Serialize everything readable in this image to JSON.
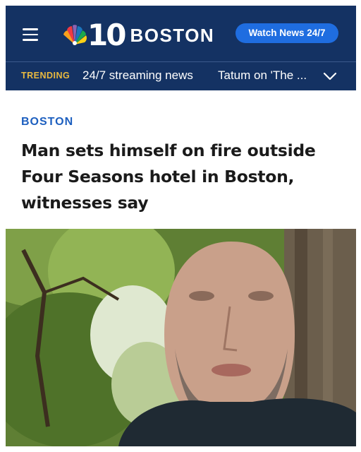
{
  "header": {
    "logo_number": "10",
    "logo_city": "BOSTON",
    "watch_button_label": "Watch News 24/7",
    "trending_label": "TRENDING",
    "trending_items": [
      "24/7 streaming news",
      "Tatum on 'The ..."
    ]
  },
  "article": {
    "section": "BOSTON",
    "headline": "Man sets himself on fire outside Four Seasons hotel in Boston, witnesses say"
  },
  "icons": {
    "menu": "hamburger-menu-icon",
    "logo": "nbc-peacock-logo-icon",
    "expand": "chevron-down-icon"
  },
  "colors": {
    "header_bg": "#143263",
    "trending_label": "#e9b93f",
    "watch_button": "#1f6de0",
    "section_label": "#1d5fbf"
  }
}
